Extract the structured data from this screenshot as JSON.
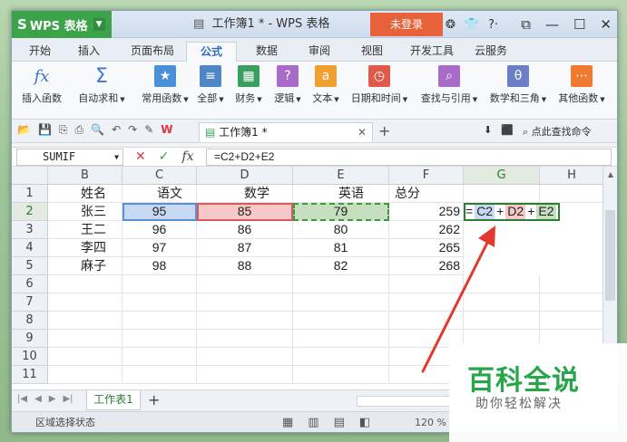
{
  "titlebar": {
    "app_name": "WPS 表格",
    "doc_title": "工作簿1 * - WPS 表格",
    "login": "未登录"
  },
  "menu_tabs": [
    "开始",
    "插入",
    "页面布局",
    "公式",
    "数据",
    "审阅",
    "视图",
    "开发工具",
    "云服务"
  ],
  "active_menu": "公式",
  "ribbon": [
    {
      "label": "插入函数",
      "icon": "fx-icon",
      "color": "#3a78c8"
    },
    {
      "label": "自动求和",
      "icon": "sigma-icon",
      "color": "#3a78c8"
    },
    {
      "label": "常用函数",
      "icon": "star-icon",
      "color": "#4a90d9"
    },
    {
      "label": "全部",
      "icon": "list-icon",
      "color": "#4f86c6"
    },
    {
      "label": "财务",
      "icon": "finance-icon",
      "color": "#3aa060"
    },
    {
      "label": "逻辑",
      "icon": "logic-icon",
      "color": "#a86bc9"
    },
    {
      "label": "文本",
      "icon": "text-icon",
      "color": "#f0a030"
    },
    {
      "label": "日期和时间",
      "icon": "clock-icon",
      "color": "#e05a4a"
    },
    {
      "label": "查找与引用",
      "icon": "search-icon",
      "color": "#a86bc9"
    },
    {
      "label": "数学和三角",
      "icon": "math-icon",
      "color": "#6b7fc9"
    },
    {
      "label": "其他函数",
      "icon": "more-icon",
      "color": "#f07a30"
    }
  ],
  "doc_tab": "工作簿1 *",
  "right_tool_search": "点此查找命令",
  "formula": {
    "name_box": "SUMIF",
    "content": "=C2+D2+E2"
  },
  "columns": [
    "B",
    "C",
    "D",
    "E",
    "F",
    "G",
    "H"
  ],
  "rows": [
    "1",
    "2",
    "3",
    "4",
    "5",
    "6",
    "7",
    "8",
    "9",
    "10",
    "11"
  ],
  "table": {
    "headers": [
      "姓名",
      "语文",
      "数学",
      "英语",
      "总分"
    ],
    "data": [
      [
        "张三",
        "95",
        "85",
        "79",
        "259"
      ],
      [
        "王二",
        "96",
        "86",
        "80",
        "262"
      ],
      [
        "李四",
        "97",
        "87",
        "81",
        "265"
      ],
      [
        "麻子",
        "98",
        "88",
        "82",
        "268"
      ]
    ]
  },
  "edit_cell_tokens": [
    "=",
    "C2",
    "+",
    "D2",
    "+",
    "E2"
  ],
  "sheet_tab": "工作表1",
  "status": {
    "text": "区域选择状态",
    "zoom": "120 %"
  },
  "watermark": {
    "title": "百科全说",
    "subtitle": "助你轻松解决"
  }
}
